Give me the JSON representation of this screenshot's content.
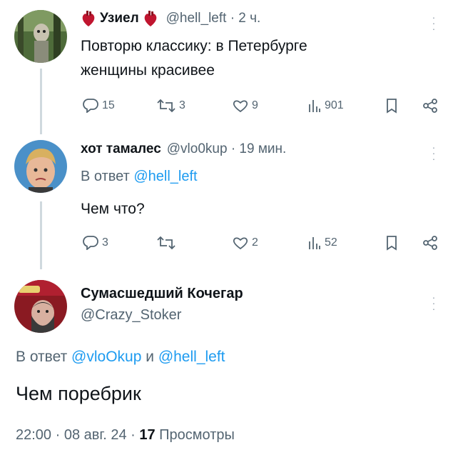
{
  "tweet1": {
    "name": "Узиел",
    "handle": "@hell_left · 2 ч.",
    "text_line1": "Повторю классику: в Петербурге",
    "text_line2": "женщины красивее",
    "replies": "15",
    "retweets": "3",
    "likes": "9",
    "views": "901"
  },
  "tweet2": {
    "name": "хот тамалес",
    "handle": "@vlo0kup · 19 мин.",
    "reply_prefix": "В ответ ",
    "reply_to": "@hell_left",
    "text": "Чем что?",
    "replies": "3",
    "retweets": "",
    "likes": "2",
    "views": "52"
  },
  "tweet3": {
    "name": "Сумасшедший Кочегар",
    "handle": "@Crazy_Stoker",
    "reply_prefix": "В ответ ",
    "reply_to_1": "@vloOkup",
    "reply_join": " и ",
    "reply_to_2": "@hell_left",
    "text": "Чем поребрик",
    "time": "22:00 · 08 авг. 24 · ",
    "views_count": "17",
    "views_label": " Просмотры"
  },
  "colors": {
    "link": "#1d9bf0",
    "muted": "#536471",
    "heart": "#c0152f"
  }
}
